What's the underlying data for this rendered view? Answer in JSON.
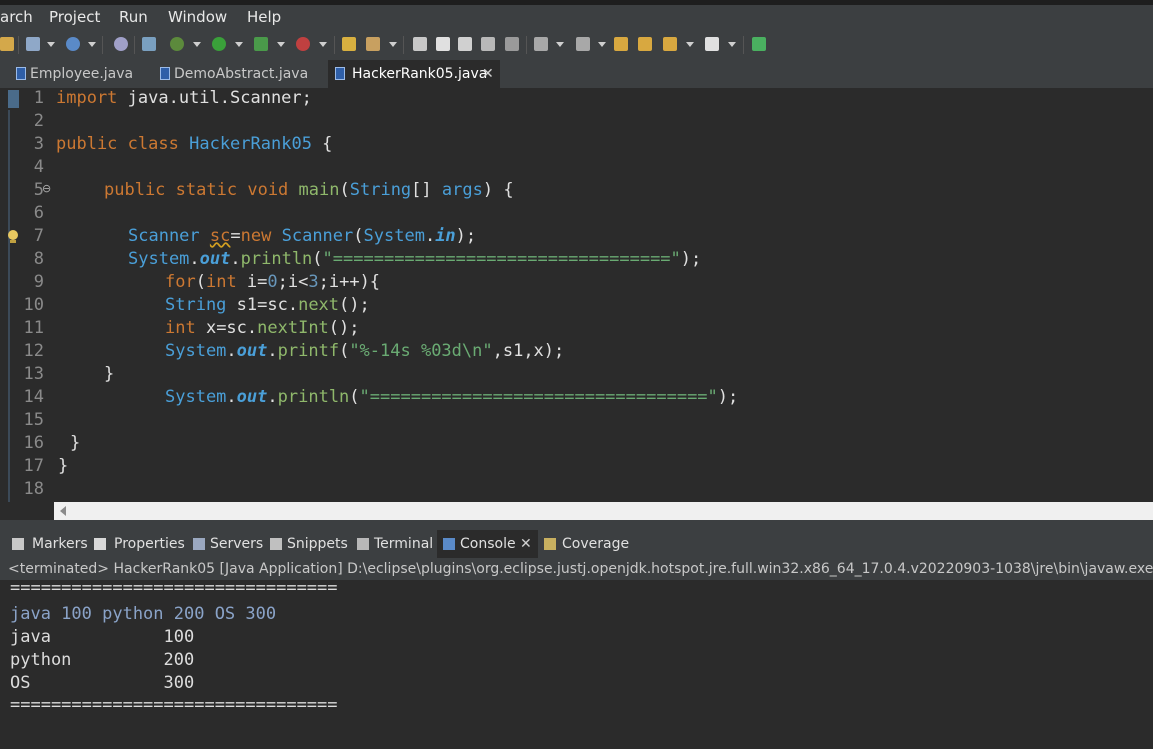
{
  "menu": [
    "arch",
    "Project",
    "Run",
    "Window",
    "Help"
  ],
  "editor_tabs": [
    {
      "label": "Employee.java"
    },
    {
      "label": "DemoAbstract.java"
    },
    {
      "label": "HackerRank05.java",
      "close": "✕"
    }
  ],
  "line_numbers": [
    "1",
    "2",
    "3",
    "4",
    "5",
    "6",
    "7",
    "8",
    "9",
    "10",
    "11",
    "12",
    "13",
    "14",
    "15",
    "16",
    "17",
    "18"
  ],
  "fold_marker": "⊖",
  "code": {
    "l1": {
      "kw": "import",
      "rest": " java.util.Scanner;"
    },
    "l3": {
      "kw1": "public",
      "kw2": "class",
      "cls": "HackerRank05",
      "brace": " {"
    },
    "l5": {
      "kw1": "public",
      "kw2": "static",
      "kw3": "void",
      "fn": "main",
      "p1": "(",
      "ty": "String",
      "p2": "[] ",
      "arg": "args",
      "p3": ") {"
    },
    "l7": {
      "ty": "Scanner",
      "var": "sc",
      "eq": "=",
      "kw": "new",
      "ty2": "Scanner",
      "p1": "(",
      "sys": "System",
      "dot": ".",
      "fld": "in",
      "p2": ");"
    },
    "l8": {
      "sys": "System",
      "dot": ".",
      "fld": "out",
      "dot2": ".",
      "fn": "println",
      "p1": "(",
      "str": "\"=================================\"",
      "p2": ");"
    },
    "l9": {
      "kw": "for",
      "p1": "(",
      "kw2": "int",
      "rest1": " i=",
      "n0": "0",
      "rest2": ";i<",
      "n3": "3",
      "rest3": ";i++){"
    },
    "l10": {
      "ty": "String",
      "rest": " s1=sc.",
      "fn": "next",
      "p": "();"
    },
    "l11": {
      "kw": "int",
      "rest": " x=sc.",
      "fn": "nextInt",
      "p": "();"
    },
    "l12": {
      "sys": "System",
      "dot": ".",
      "fld": "out",
      "dot2": ".",
      "fn": "printf",
      "p1": "(",
      "str": "\"%-14s %03d\\n\"",
      "rest": ",s1,x);"
    },
    "l13": "}",
    "l14": {
      "sys": "System",
      "dot": ".",
      "fld": "out",
      "dot2": ".",
      "fn": "println",
      "p1": "(",
      "str": "\"=================================\"",
      "p2": ");"
    },
    "l16": "}",
    "l17": "}"
  },
  "views": [
    "Markers",
    "Properties",
    "Servers",
    "Snippets",
    "Terminal",
    "Console",
    "Coverage"
  ],
  "console_status": "<terminated> HackerRank05 [Java Application] D:\\eclipse\\plugins\\org.eclipse.justj.openjdk.hotspot.jre.full.win32.x86_64_17.0.4.v20220903-1038\\jre\\bin\\javaw.exe  (04-Oct-20",
  "console_lines": [
    "================================",
    "java 100 python 200 OS 300",
    "java           100",
    "python         200",
    "OS             300",
    "================================"
  ],
  "colors": {
    "keyword": "#cc7832",
    "type": "#4a9fd8",
    "method": "#8fb86b",
    "string": "#6aab73",
    "number": "#6897bb"
  }
}
